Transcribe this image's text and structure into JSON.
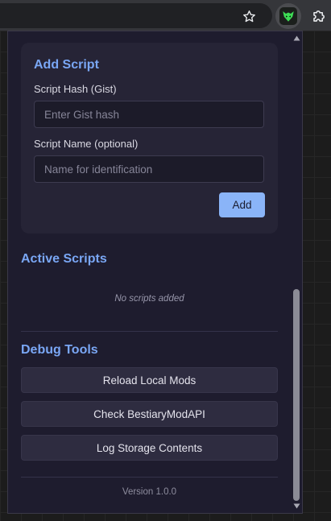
{
  "popup": {
    "add_script": {
      "title": "Add Script",
      "hash_label": "Script Hash (Gist)",
      "hash_value": "",
      "hash_placeholder": "Enter Gist hash",
      "name_label": "Script Name (optional)",
      "name_value": "",
      "name_placeholder": "Name for identification",
      "add_label": "Add"
    },
    "active_scripts": {
      "title": "Active Scripts",
      "empty_message": "No scripts added"
    },
    "debug_tools": {
      "title": "Debug Tools",
      "buttons": [
        {
          "label": "Reload Local Mods"
        },
        {
          "label": "Check BestiaryModAPI"
        },
        {
          "label": "Log Storage Contents"
        }
      ]
    },
    "version": "Version 1.0.0"
  },
  "toolbar": {
    "icons": [
      "star-icon",
      "extension-icon",
      "puzzle-icon"
    ]
  },
  "colors": {
    "accent": "#8ab4f8",
    "section_title": "#7aa7f5",
    "popup_bg": "#1e1c2e",
    "card_bg": "#262436"
  }
}
